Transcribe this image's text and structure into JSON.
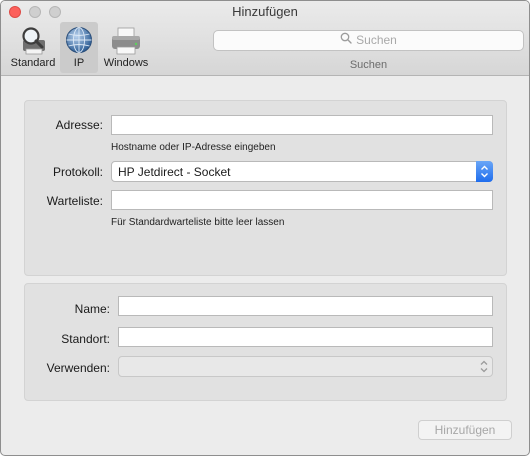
{
  "window": {
    "title": "Hinzufügen"
  },
  "toolbar": {
    "items": [
      {
        "label": "Standard",
        "icon": "printer-magnifier-icon",
        "selected": false
      },
      {
        "label": "IP",
        "icon": "globe-icon",
        "selected": true
      },
      {
        "label": "Windows",
        "icon": "windows-printer-icon",
        "selected": false
      }
    ]
  },
  "search": {
    "placeholder": "Suchen",
    "caption": "Suchen"
  },
  "ip_panel": {
    "address": {
      "label": "Adresse:",
      "value": "",
      "hint": "Hostname oder IP-Adresse eingeben"
    },
    "protocol": {
      "label": "Protokoll:",
      "value": "HP Jetdirect - Socket"
    },
    "queue": {
      "label": "Warteliste:",
      "value": "",
      "hint": "Für Standardwarteliste bitte leer lassen"
    }
  },
  "info_panel": {
    "name": {
      "label": "Name:",
      "value": ""
    },
    "location": {
      "label": "Standort:",
      "value": ""
    },
    "use": {
      "label": "Verwenden:",
      "value": ""
    }
  },
  "footer": {
    "add_button": "Hinzufügen"
  },
  "colors": {
    "accent": "#1f6ded",
    "close": "#fc605b"
  }
}
